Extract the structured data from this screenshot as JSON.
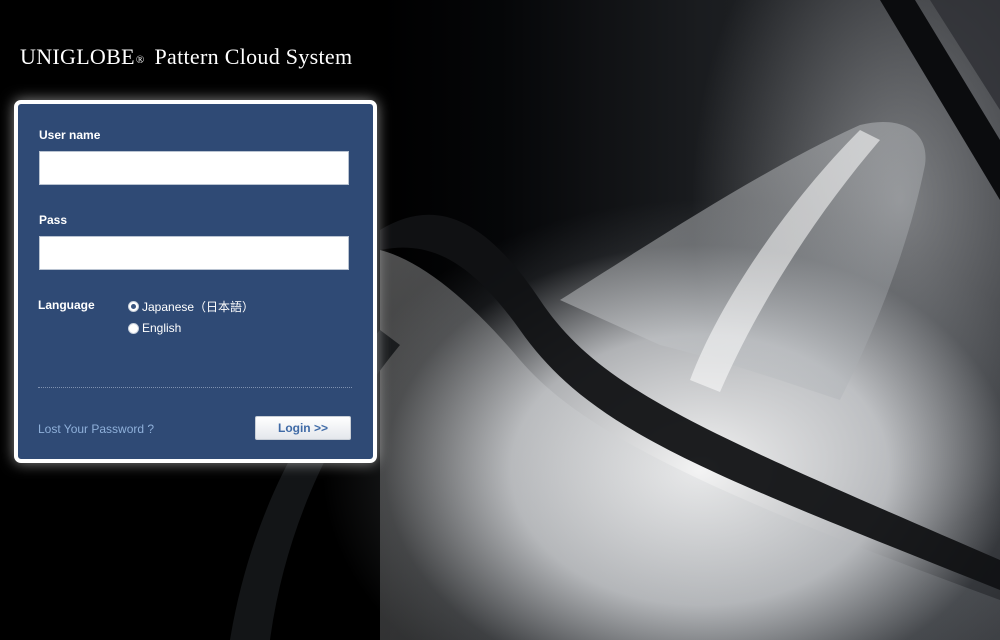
{
  "header": {
    "brand": "UNIGLOBE",
    "registered_mark": "®",
    "product": "Pattern Cloud System"
  },
  "login_form": {
    "username_label": "User name",
    "username_value": "",
    "password_label": "Pass",
    "password_value": "",
    "language_label": "Language",
    "language_options": [
      {
        "label": "Japanese（日本語）",
        "selected": true
      },
      {
        "label": "English",
        "selected": false
      }
    ],
    "lost_password_link": "Lost Your Password ?",
    "login_button": "Login >>"
  },
  "colors": {
    "panel_background": "#2f4a75",
    "panel_border": "#ffffff",
    "link": "#8fb0da",
    "button_text": "#3f6aa6"
  }
}
